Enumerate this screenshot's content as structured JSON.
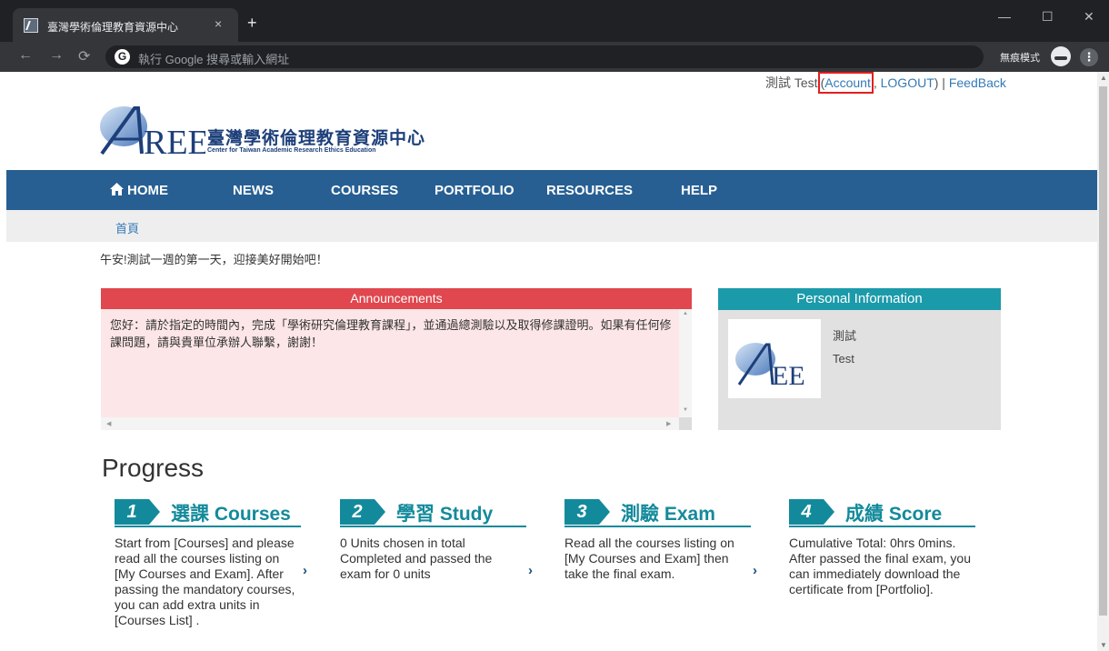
{
  "browser": {
    "tab_title": "臺灣學術倫理教育資源中心",
    "tab_close": "×",
    "new_tab": "+",
    "omnibox_g": "G",
    "omnibox_placeholder": "執行 Google 搜尋或輸入網址",
    "incognito_label": "無痕模式",
    "win_minimize": "—",
    "win_maximize": "☐",
    "win_close": "✕"
  },
  "userbar": {
    "name": "測試 Test",
    "open_paren": "(",
    "account": "Account",
    "sep": ", ",
    "logout": "LOGOUT",
    "close_paren": ") | ",
    "feedback": "FeedBack"
  },
  "logo": {
    "title": "臺灣學術倫理教育資源中心",
    "subtitle": "Center for Taiwan Academic Research Ethics Education"
  },
  "nav": {
    "home": "HOME",
    "news": "NEWS",
    "courses": "COURSES",
    "portfolio": "PORTFOLIO",
    "resources": "RESOURCES",
    "help": "HELP"
  },
  "breadcrumb": {
    "home": "首頁"
  },
  "greeting": "午安!測試一週的第一天，迎接美好開始吧！",
  "announcements": {
    "title": "Announcements",
    "text": "您好：請於指定的時間內，完成「學術研究倫理教育課程」，並通過總測驗以及取得修課證明。如果有任何修課問題，請與貴單位承辦人聯繫，謝謝！"
  },
  "personal": {
    "title": "Personal Information",
    "name_zh": "測試",
    "name_en": "Test"
  },
  "progress": {
    "title": "Progress",
    "steps": [
      {
        "num": "1",
        "label": "選課 Courses",
        "text": "Start from [Courses] and please read all the courses listing on [My Courses and Exam]. After passing the mandatory courses, you can add extra units in [Courses List] ."
      },
      {
        "num": "2",
        "label": "學習 Study",
        "text": "0 Units chosen in total Completed and passed the exam for 0 units"
      },
      {
        "num": "3",
        "label": "測驗 Exam",
        "text": "Read all the courses listing on [My Courses and Exam] then take the final exam."
      },
      {
        "num": "4",
        "label": "成績 Score",
        "text": "Cumulative Total: 0hrs 0mins. After passed the final exam, you can immediately download the certificate from [Portfolio]."
      }
    ],
    "chevron": "›"
  },
  "colors": {
    "nav_bg": "#275f93",
    "announce_head": "#e0474e",
    "announce_body": "#fde6e7",
    "info_head": "#1b9aaa",
    "step_accent": "#138a9b",
    "account_highlight": "#e0201e"
  }
}
